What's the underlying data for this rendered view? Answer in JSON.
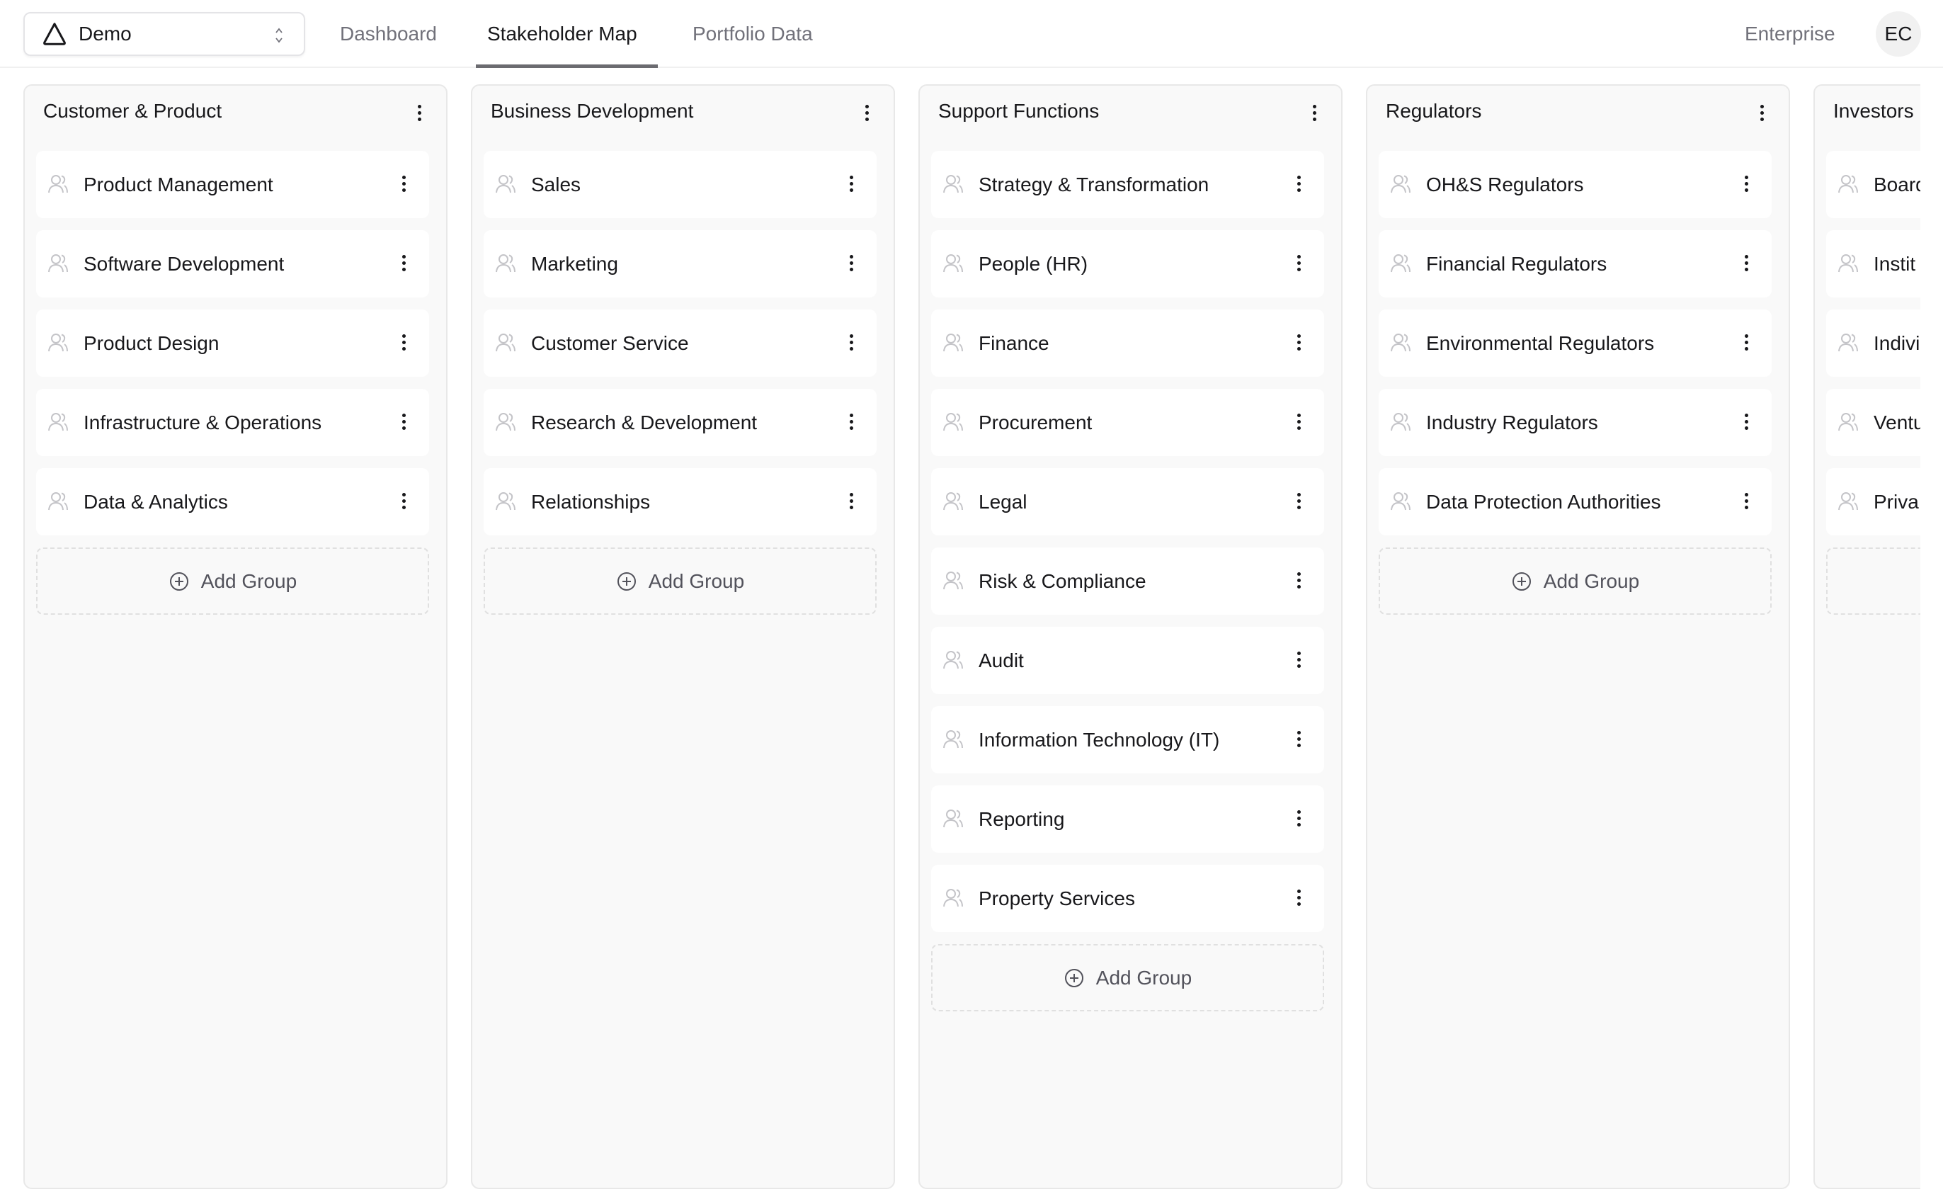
{
  "header": {
    "workspace": "Demo",
    "tabs": [
      {
        "label": "Dashboard",
        "active": false
      },
      {
        "label": "Stakeholder Map",
        "active": true
      },
      {
        "label": "Portfolio Data",
        "active": false
      }
    ],
    "plan": "Enterprise",
    "avatar_initials": "EC"
  },
  "add_group_label": "Add Group",
  "columns": [
    {
      "title": "Customer & Product",
      "groups": [
        "Product Management",
        "Software Development",
        "Product Design",
        "Infrastructure & Operations",
        "Data & Analytics"
      ]
    },
    {
      "title": "Business Development",
      "groups": [
        "Sales",
        "Marketing",
        "Customer Service",
        "Research & Development",
        "Relationships"
      ]
    },
    {
      "title": "Support Functions",
      "groups": [
        "Strategy & Transformation",
        "People (HR)",
        "Finance",
        "Procurement",
        "Legal",
        "Risk & Compliance",
        "Audit",
        "Information Technology (IT)",
        "Reporting",
        "Property Services"
      ]
    },
    {
      "title": "Regulators",
      "groups": [
        "OH&S Regulators",
        "Financial Regulators",
        "Environmental Regulators",
        "Industry Regulators",
        "Data Protection Authorities"
      ]
    },
    {
      "title": "Investors",
      "groups": [
        "Board",
        "Instit",
        "Indivi",
        "Ventu",
        "Priva"
      ]
    }
  ]
}
